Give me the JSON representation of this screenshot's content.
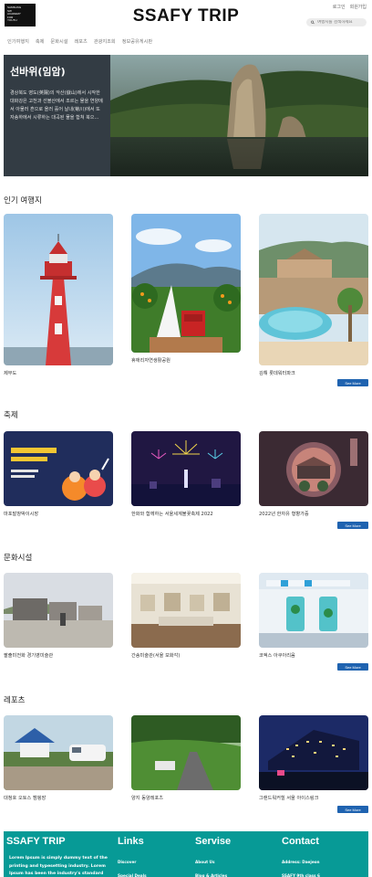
{
  "header": {
    "logo_lines": [
      "SAMSUNG",
      "SW",
      "ACADEMY",
      "FOR",
      "YOUTH"
    ],
    "title": "SSAFY TRIP",
    "login": "로그인",
    "signup": "회원가입",
    "search_placeholder": "여행지를 검색하세요"
  },
  "nav": [
    "인기여행지",
    "축제",
    "문화시설",
    "레포츠",
    "관광지조회",
    "정보공유게시판"
  ],
  "hero": {
    "title": "선바위(임암)",
    "description": "경상북도 영도(英陽)의 악산(嶽山)에서 시작한 대화강은 고천과 선블산에서 조르는 물을 연양에서 아물러 흔으로 올러 흘어 날내(菊川)에서 또 자송하에서 시류하는 대곡된 물을 합쳐 북으..."
  },
  "sections": [
    {
      "title": "인기 여행지",
      "items": [
        "제부도",
        "휴애리자연생활공원",
        "김해 롯데워터파크"
      ],
      "more": "See More"
    },
    {
      "title": "축제",
      "items": [
        "마포발창박이시장",
        "한화와 함께하는 서울세계불꽃축제 2022",
        "2022년 한자유 형향가중"
      ],
      "more": "See More"
    },
    {
      "title": "문화시설",
      "items": [
        "팔출미전화 경기영미술관",
        "간송미술관(서울 보화각)",
        "코엑스 아쿠아리움"
      ],
      "more": "See More"
    },
    {
      "title": "레포츠",
      "items": [
        "대청호 오토스 캠핑장",
        "양지 동양레포츠",
        "그랜드워커힐 서울 아이스링크"
      ],
      "more": "See More"
    }
  ],
  "footer": {
    "brand": "SSAFY TRIP",
    "about_text": "Lorem Ipsum is simply dummy text of the printing and typesetting industry. Lorem Ipsum has been the industry's standard",
    "columns": [
      {
        "title": "Links",
        "items": [
          "Discover",
          "Special Deals"
        ]
      },
      {
        "title": "Servise",
        "items": [
          "About Us",
          "Blog & Articles"
        ]
      },
      {
        "title": "Contact",
        "items": [
          "Address: Daejeon",
          "SSAFY 9th class 6"
        ]
      }
    ]
  }
}
